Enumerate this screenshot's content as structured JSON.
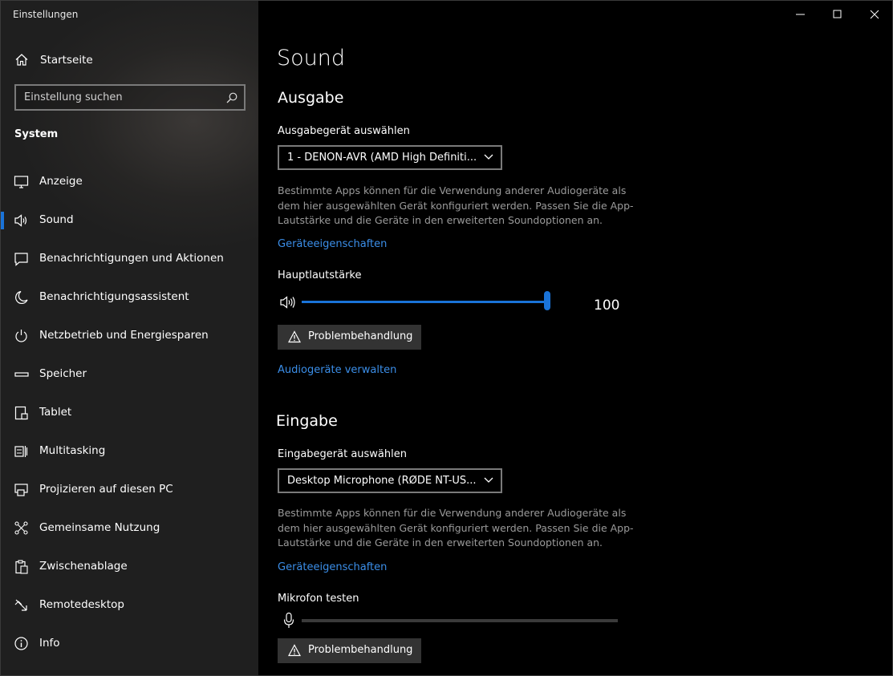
{
  "window": {
    "title": "Einstellungen"
  },
  "sidebar": {
    "home_label": "Startseite",
    "search_placeholder": "Einstellung suchen",
    "section": "System",
    "items": [
      {
        "label": "Anzeige",
        "icon": "monitor-icon",
        "selected": false
      },
      {
        "label": "Sound",
        "icon": "speaker-icon",
        "selected": true
      },
      {
        "label": "Benachrichtigungen und Aktionen",
        "icon": "notification-icon",
        "selected": false
      },
      {
        "label": "Benachrichtigungsassistent",
        "icon": "moon-icon",
        "selected": false
      },
      {
        "label": "Netzbetrieb und Energiesparen",
        "icon": "power-icon",
        "selected": false
      },
      {
        "label": "Speicher",
        "icon": "storage-icon",
        "selected": false
      },
      {
        "label": "Tablet",
        "icon": "tablet-icon",
        "selected": false
      },
      {
        "label": "Multitasking",
        "icon": "multitasking-icon",
        "selected": false
      },
      {
        "label": "Projizieren auf diesen PC",
        "icon": "project-icon",
        "selected": false
      },
      {
        "label": "Gemeinsame Nutzung",
        "icon": "share-icon",
        "selected": false
      },
      {
        "label": "Zwischenablage",
        "icon": "clipboard-icon",
        "selected": false
      },
      {
        "label": "Remotedesktop",
        "icon": "remote-desktop-icon",
        "selected": false
      },
      {
        "label": "Info",
        "icon": "info-icon",
        "selected": false
      }
    ]
  },
  "main": {
    "title": "Sound",
    "output": {
      "heading": "Ausgabe",
      "device_label": "Ausgabegerät auswählen",
      "device_value": "1 - DENON-AVR (AMD High Definiti...",
      "description": "Bestimmte Apps können für die Verwendung anderer Audiogeräte als dem hier ausgewählten Gerät konfiguriert werden. Passen Sie die App-Lautstärke und die Geräte in den erweiterten Soundoptionen an.",
      "properties_link": "Geräteeigenschaften",
      "volume_label": "Hauptlautstärke",
      "volume_value": "100",
      "volume_fraction": 1.0,
      "troubleshoot_label": "Problembehandlung",
      "manage_link": "Audiogeräte verwalten"
    },
    "input": {
      "heading": "Eingabe",
      "device_label": "Eingabegerät auswählen",
      "device_value": "Desktop Microphone (RØDE NT-US...",
      "description": "Bestimmte Apps können für die Verwendung anderer Audiogeräte als dem hier ausgewählten Gerät konfiguriert werden. Passen Sie die App-Lautstärke und die Geräte in den erweiterten Soundoptionen an.",
      "properties_link": "Geräteeigenschaften",
      "mic_test_label": "Mikrofon testen",
      "mic_level_fraction": 0.0,
      "troubleshoot_label": "Problembehandlung"
    }
  },
  "colors": {
    "accent": "#1a73d8",
    "link": "#3b8ee8"
  }
}
